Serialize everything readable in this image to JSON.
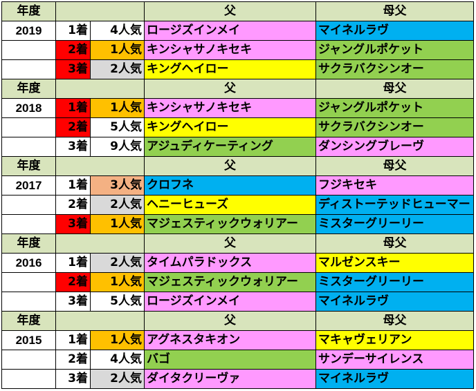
{
  "headers": {
    "year": "年度",
    "sire": "父",
    "broodmare_sire": "母父"
  },
  "colors": {
    "header": "#d8e4bc",
    "red": "#ff0000",
    "orange": "#ffc000",
    "salmon": "#f4b183",
    "gray": "#d9d9d9",
    "pink": "#ff99ff",
    "blue": "#00b0f0",
    "yellow": "#ffff00",
    "green": "#92d050"
  },
  "groups": [
    {
      "year": "2019",
      "rows": [
        {
          "rank": "1着",
          "rank_color": "none",
          "pop": "4人気",
          "pop_color": "none",
          "sire": "ロージズインメイ",
          "sire_color": "pink",
          "dam_sire": "マイネルラヴ",
          "dam_sire_color": "blue"
        },
        {
          "rank": "2着",
          "rank_color": "red",
          "pop": "1人気",
          "pop_color": "orange",
          "sire": "キンシャサノキセキ",
          "sire_color": "pink",
          "dam_sire": "ジャングルポケット",
          "dam_sire_color": "green"
        },
        {
          "rank": "3着",
          "rank_color": "red",
          "pop": "2人気",
          "pop_color": "gray",
          "sire": "キングヘイロー",
          "sire_color": "yellow",
          "dam_sire": "サクラバクシンオー",
          "dam_sire_color": "green"
        }
      ]
    },
    {
      "year": "2018",
      "rows": [
        {
          "rank": "1着",
          "rank_color": "red",
          "pop": "1人気",
          "pop_color": "orange",
          "sire": "キンシャサノキセキ",
          "sire_color": "pink",
          "dam_sire": "ジャングルポケット",
          "dam_sire_color": "green"
        },
        {
          "rank": "2着",
          "rank_color": "red",
          "pop": "5人気",
          "pop_color": "none",
          "sire": "キングヘイロー",
          "sire_color": "yellow",
          "dam_sire": "サクラバクシンオー",
          "dam_sire_color": "green"
        },
        {
          "rank": "3着",
          "rank_color": "none",
          "pop": "9人気",
          "pop_color": "none",
          "sire": "アジュディケーティング",
          "sire_color": "green",
          "dam_sire": "ダンシングブレーヴ",
          "dam_sire_color": "pink"
        }
      ]
    },
    {
      "year": "2017",
      "rows": [
        {
          "rank": "1着",
          "rank_color": "none",
          "pop": "3人気",
          "pop_color": "salmon",
          "sire": "クロフネ",
          "sire_color": "blue",
          "dam_sire": "フジキセキ",
          "dam_sire_color": "pink"
        },
        {
          "rank": "2着",
          "rank_color": "none",
          "pop": "2人気",
          "pop_color": "gray",
          "sire": "ヘニーヒューズ",
          "sire_color": "yellow",
          "dam_sire": "ディストーテッドヒューマー",
          "dam_sire_color": "blue"
        },
        {
          "rank": "3着",
          "rank_color": "red",
          "pop": "1人気",
          "pop_color": "orange",
          "sire": "マジェスティックウォリアー",
          "sire_color": "green",
          "dam_sire": "ミスターグリーリー",
          "dam_sire_color": "blue"
        }
      ]
    },
    {
      "year": "2016",
      "rows": [
        {
          "rank": "1着",
          "rank_color": "none",
          "pop": "2人気",
          "pop_color": "gray",
          "sire": "タイムパラドックス",
          "sire_color": "pink",
          "dam_sire": "マルゼンスキー",
          "dam_sire_color": "yellow"
        },
        {
          "rank": "2着",
          "rank_color": "red",
          "pop": "1人気",
          "pop_color": "orange",
          "sire": "マジェスティックウォリアー",
          "sire_color": "green",
          "dam_sire": "ミスターグリーリー",
          "dam_sire_color": "blue"
        },
        {
          "rank": "3着",
          "rank_color": "none",
          "pop": "5人気",
          "pop_color": "none",
          "sire": "ロージズインメイ",
          "sire_color": "pink",
          "dam_sire": "マイネルラヴ",
          "dam_sire_color": "blue"
        }
      ]
    },
    {
      "year": "2015",
      "rows": [
        {
          "rank": "1着",
          "rank_color": "none",
          "pop": "1人気",
          "pop_color": "orange",
          "sire": "アグネスタキオン",
          "sire_color": "pink",
          "dam_sire": "マキャヴェリアン",
          "dam_sire_color": "yellow"
        },
        {
          "rank": "2着",
          "rank_color": "none",
          "pop": "4人気",
          "pop_color": "none",
          "sire": "バゴ",
          "sire_color": "green",
          "dam_sire": "サンデーサイレンス",
          "dam_sire_color": "pink"
        },
        {
          "rank": "3着",
          "rank_color": "none",
          "pop": "2人気",
          "pop_color": "gray",
          "sire": "ダイタクリーヴァ",
          "sire_color": "pink",
          "dam_sire": "マイネルラヴ",
          "dam_sire_color": "blue"
        }
      ]
    }
  ]
}
